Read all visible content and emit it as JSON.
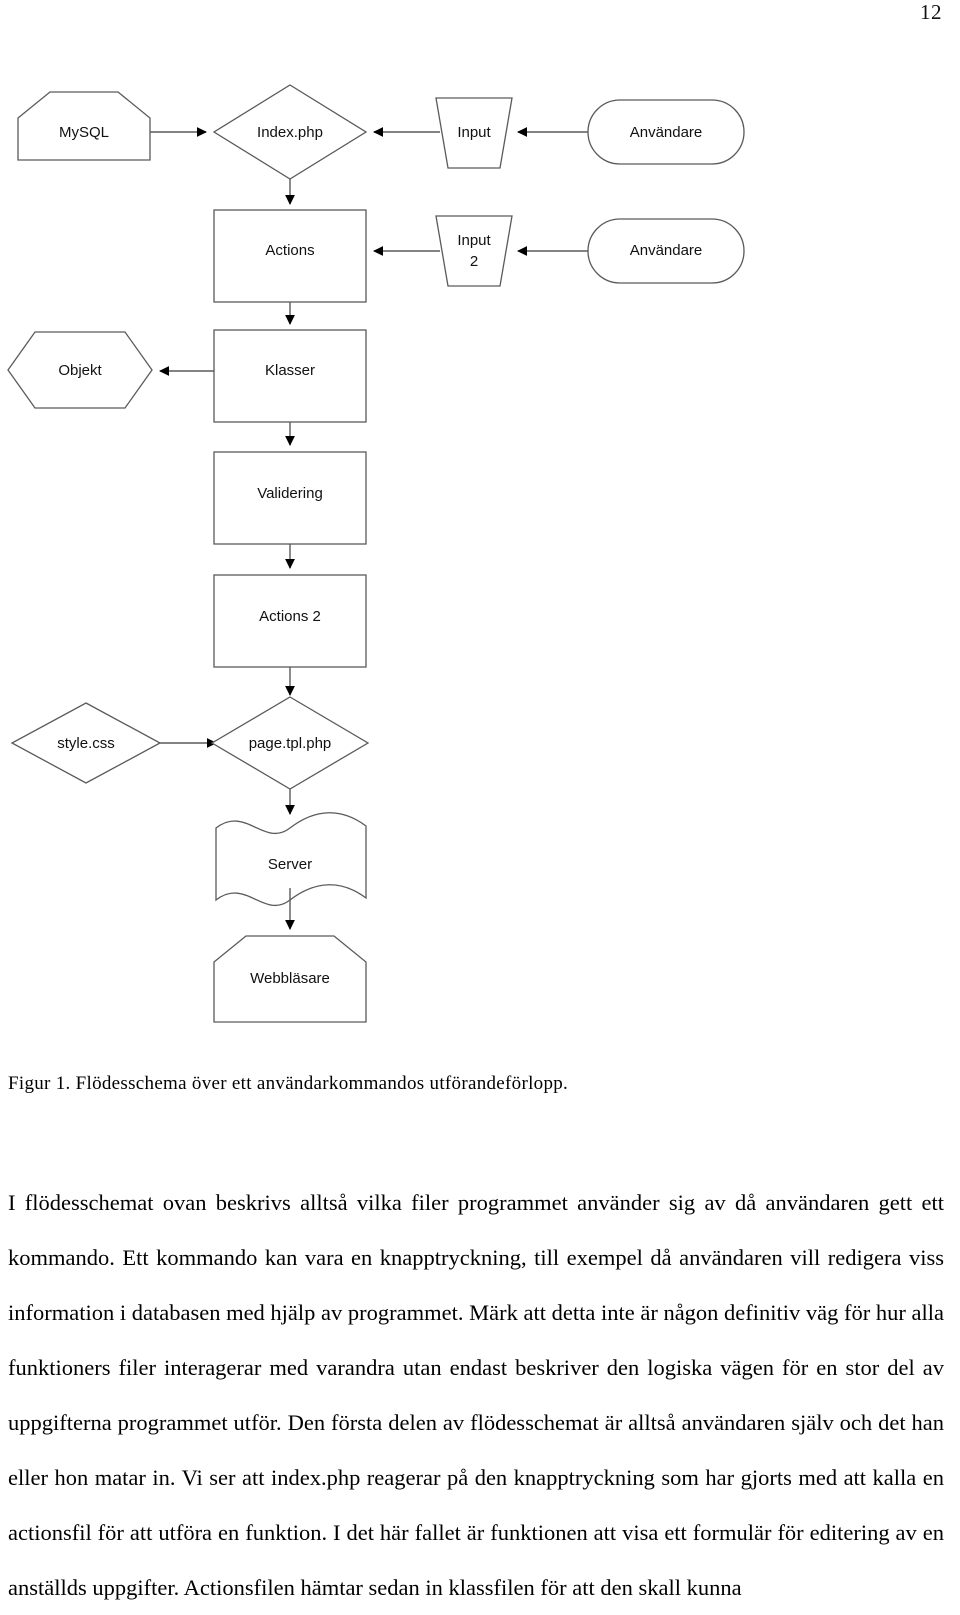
{
  "page": {
    "number": "12"
  },
  "figure": {
    "caption": "Figur 1. Flödesschema över ett användarkommandos utförandeförlopp.",
    "nodes": {
      "mysql": {
        "label": "MySQL",
        "shape": "cut-corner-pentagon"
      },
      "index_php": {
        "label": "Index.php",
        "shape": "diamond"
      },
      "input1": {
        "label": "Input",
        "shape": "inverted-trapezoid"
      },
      "anvandare1": {
        "label": "Användare",
        "shape": "stadium"
      },
      "actions": {
        "label": "Actions",
        "shape": "rectangle"
      },
      "input2_line1": {
        "label": "Input",
        "shape": "inverted-trapezoid"
      },
      "input2_line2": {
        "label": "2"
      },
      "anvandare2": {
        "label": "Användare",
        "shape": "stadium"
      },
      "objekt": {
        "label": "Objekt",
        "shape": "hexagon"
      },
      "klasser": {
        "label": "Klasser",
        "shape": "rectangle"
      },
      "validering": {
        "label": "Validering",
        "shape": "rectangle"
      },
      "actions2": {
        "label": "Actions 2",
        "shape": "rectangle"
      },
      "style_css": {
        "label": "style.css",
        "shape": "diamond"
      },
      "page_tpl_php": {
        "label": "page.tpl.php",
        "shape": "diamond"
      },
      "server": {
        "label": "Server",
        "shape": "wave-document"
      },
      "webblasare": {
        "label": "Webbläsare",
        "shape": "cut-corner-pentagon"
      }
    },
    "edges": [
      {
        "from": "mysql",
        "to": "index_php",
        "direction": "right"
      },
      {
        "from": "input1",
        "to": "index_php",
        "direction": "left"
      },
      {
        "from": "anvandare1",
        "to": "input1",
        "direction": "left"
      },
      {
        "from": "index_php",
        "to": "actions",
        "direction": "down"
      },
      {
        "from": "input2",
        "to": "actions",
        "direction": "left"
      },
      {
        "from": "anvandare2",
        "to": "input2",
        "direction": "left"
      },
      {
        "from": "actions",
        "to": "klasser",
        "direction": "down"
      },
      {
        "from": "klasser",
        "to": "objekt",
        "direction": "left"
      },
      {
        "from": "klasser",
        "to": "validering",
        "direction": "down"
      },
      {
        "from": "validering",
        "to": "actions2",
        "direction": "down"
      },
      {
        "from": "actions2",
        "to": "page_tpl_php",
        "direction": "down"
      },
      {
        "from": "style_css",
        "to": "page_tpl_php",
        "direction": "right"
      },
      {
        "from": "page_tpl_php",
        "to": "server",
        "direction": "down"
      },
      {
        "from": "server",
        "to": "webblasare",
        "direction": "down"
      }
    ]
  },
  "body": {
    "paragraph": "I flödesschemat ovan beskrivs alltså vilka filer programmet använder sig av då användaren gett ett kommando. Ett kommando kan vara en knapptryckning, till exempel då användaren vill redigera viss information i databasen med hjälp av programmet. Märk att detta inte är någon definitiv väg för hur alla funktioners filer interagerar med varandra utan endast beskriver den logiska vägen för en stor del av uppgifterna programmet utför. Den första delen av flödesschemat är alltså användaren själv och det han eller hon matar in. Vi ser att index.php reagerar på den knapptryckning som har gjorts med att kalla en actionsfil för att utföra en funktion. I det här fallet är funktionen att visa ett formulär för editering av en anställds uppgifter. Actionsfilen hämtar sedan in klassfilen för att den skall kunna"
  }
}
